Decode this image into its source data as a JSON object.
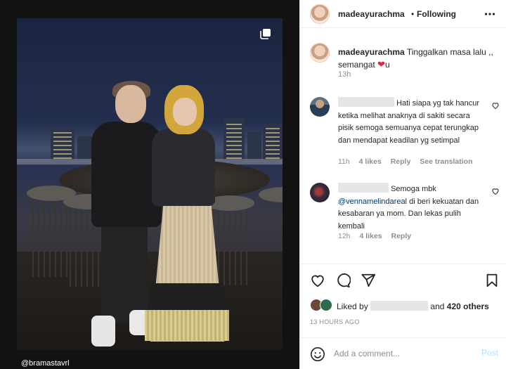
{
  "media": {
    "photo_tag": "@bramastavrl",
    "carousel_icon": "multiple-posts-icon"
  },
  "header": {
    "username": "madeayurachma",
    "separator": "•",
    "follow_status": "Following",
    "more_icon": "more-horizontal-icon"
  },
  "caption": {
    "username": "madeayurachma",
    "text_before_emoji": "Tinggalkan masa lalu ,, semangat ",
    "emoji": "❤",
    "text_after_emoji": "u",
    "time": "13h"
  },
  "comments": [
    {
      "username_redacted": true,
      "text": "Hati siapa yg tak hancur ketika melihat anaknya di sakiti secara pisik semoga semuanya cepat terungkap dan mendapat keadilan yg setimpal",
      "time": "11h",
      "likes": "4 likes",
      "reply": "Reply",
      "translate": "See translation"
    },
    {
      "username_redacted": true,
      "text_before_mention": "Semoga mbk ",
      "mention": "@vennamelindareal",
      "text_after_mention": " di beri kekuatan dan kesabaran ya mom. Dan lekas pulih kembali",
      "time": "12h",
      "likes": "4 likes",
      "reply": "Reply"
    }
  ],
  "actions": {
    "like_icon": "heart-outline-icon",
    "comment_icon": "comment-bubble-icon",
    "share_icon": "send-paper-plane-icon",
    "save_icon": "bookmark-icon"
  },
  "likes": {
    "prefix": "Liked by",
    "conjunction": "and",
    "others": "420 others"
  },
  "timestamp": "13 HOURS AGO",
  "add_comment": {
    "emoji_icon": "smiley-face-icon",
    "placeholder": "Add a comment...",
    "post_label": "Post"
  },
  "colors": {
    "text": "#262626",
    "muted": "#8e8e8e",
    "mention": "#00376b",
    "heart_emoji": "#e0243b",
    "post_disabled": "#b2dffc",
    "border": "#efefef"
  }
}
